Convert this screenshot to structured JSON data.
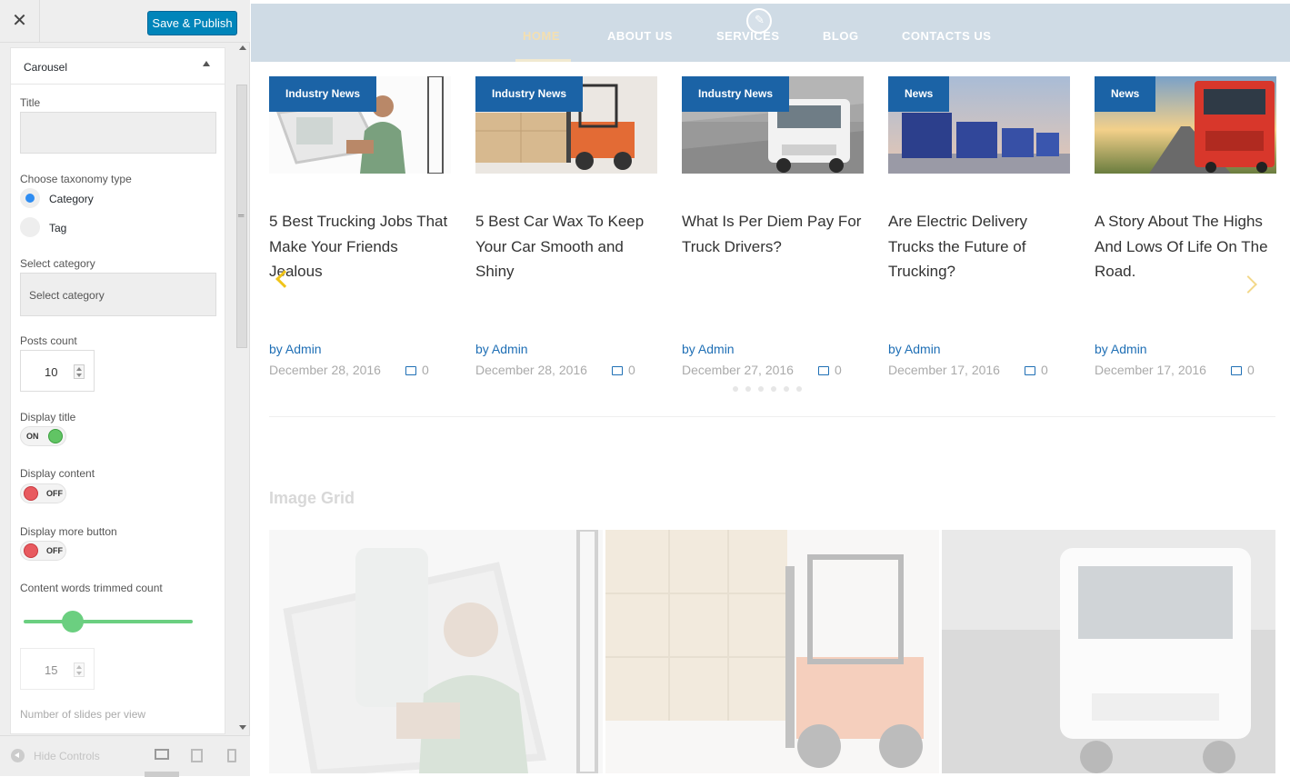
{
  "sidebar": {
    "close_glyph": "✕",
    "publish_label": "Save & Publish",
    "panel": {
      "title": "Carousel",
      "title_label": "Title",
      "title_value": "",
      "taxonomy_label": "Choose taxonomy type",
      "taxonomy_options": [
        "Category",
        "Tag"
      ],
      "taxonomy_selected": "Category",
      "select_category_label": "Select category",
      "select_category_placeholder": "Select category",
      "posts_count_label": "Posts count",
      "posts_count": "10",
      "display_title_label": "Display title",
      "display_title": "ON",
      "display_content_label": "Display content",
      "display_content": "OFF",
      "display_more_label": "Display more button",
      "display_more": "OFF",
      "trim_label": "Content words trimmed count",
      "trim_value": "15",
      "slides_label": "Number of slides per view"
    },
    "footer": {
      "hide_controls": "Hide Controls",
      "devices": [
        "desktop-icon",
        "tablet-icon",
        "mobile-icon"
      ]
    }
  },
  "preview": {
    "nav": [
      "HOME",
      "ABOUT US",
      "SERVICES",
      "BLOG",
      "CONTACTS US"
    ],
    "nav_active": "HOME",
    "posts": [
      {
        "badge": "Industry News",
        "title": "5 Best Trucking Jobs That Make Your Friends Jealous",
        "author": "by Admin",
        "date": "December 28, 2016",
        "comments": "0"
      },
      {
        "badge": "Industry News",
        "title": "5 Best Car Wax To Keep Your Car Smooth and Shiny",
        "author": "by Admin",
        "date": "December 28, 2016",
        "comments": "0"
      },
      {
        "badge": "Industry News",
        "title": "What Is Per Diem Pay For Truck Drivers?",
        "author": "by Admin",
        "date": "December 27, 2016",
        "comments": "0"
      },
      {
        "badge": "News",
        "title": "Are Electric Delivery Trucks the Future of Trucking?",
        "author": "by Admin",
        "date": "December 17, 2016",
        "comments": "0"
      },
      {
        "badge": "News",
        "title": "A Story About The Highs And Lows Of Life On The Road.",
        "author": "by Admin",
        "date": "December 17, 2016",
        "comments": "0"
      }
    ],
    "grid_title": "Image Grid"
  },
  "colors": {
    "accent_blue": "#1b63a6",
    "publish_blue": "#0085ba",
    "toggle_on": "#61c464",
    "toggle_off": "#e85a5f",
    "arrow_yellow": "#f0c419"
  }
}
